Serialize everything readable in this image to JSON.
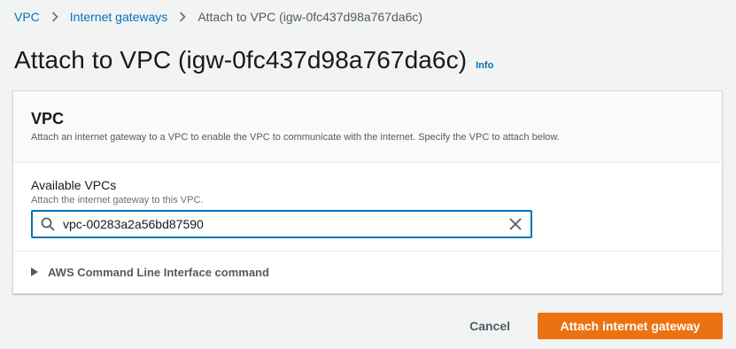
{
  "breadcrumb": {
    "items": [
      "VPC",
      "Internet gateways"
    ],
    "current": "Attach to VPC (igw-0fc437d98a767da6c)"
  },
  "header": {
    "title": "Attach to VPC (igw-0fc437d98a767da6c)",
    "info": "Info"
  },
  "panel": {
    "title": "VPC",
    "description": "Attach an internet gateway to a VPC to enable the VPC to communicate with the internet. Specify the VPC to attach below."
  },
  "field": {
    "label": "Available VPCs",
    "hint": "Attach the internet gateway to this VPC.",
    "value": "vpc-00283a2a56bd87590"
  },
  "cli": {
    "label": "AWS Command Line Interface command"
  },
  "actions": {
    "cancel": "Cancel",
    "primary": "Attach internet gateway"
  },
  "colors": {
    "link": "#0073bb",
    "primary": "#ec7211",
    "background": "#f2f3f3"
  },
  "icons": [
    "chevron-right-icon",
    "search-icon",
    "clear-icon",
    "caret-right-icon"
  ]
}
